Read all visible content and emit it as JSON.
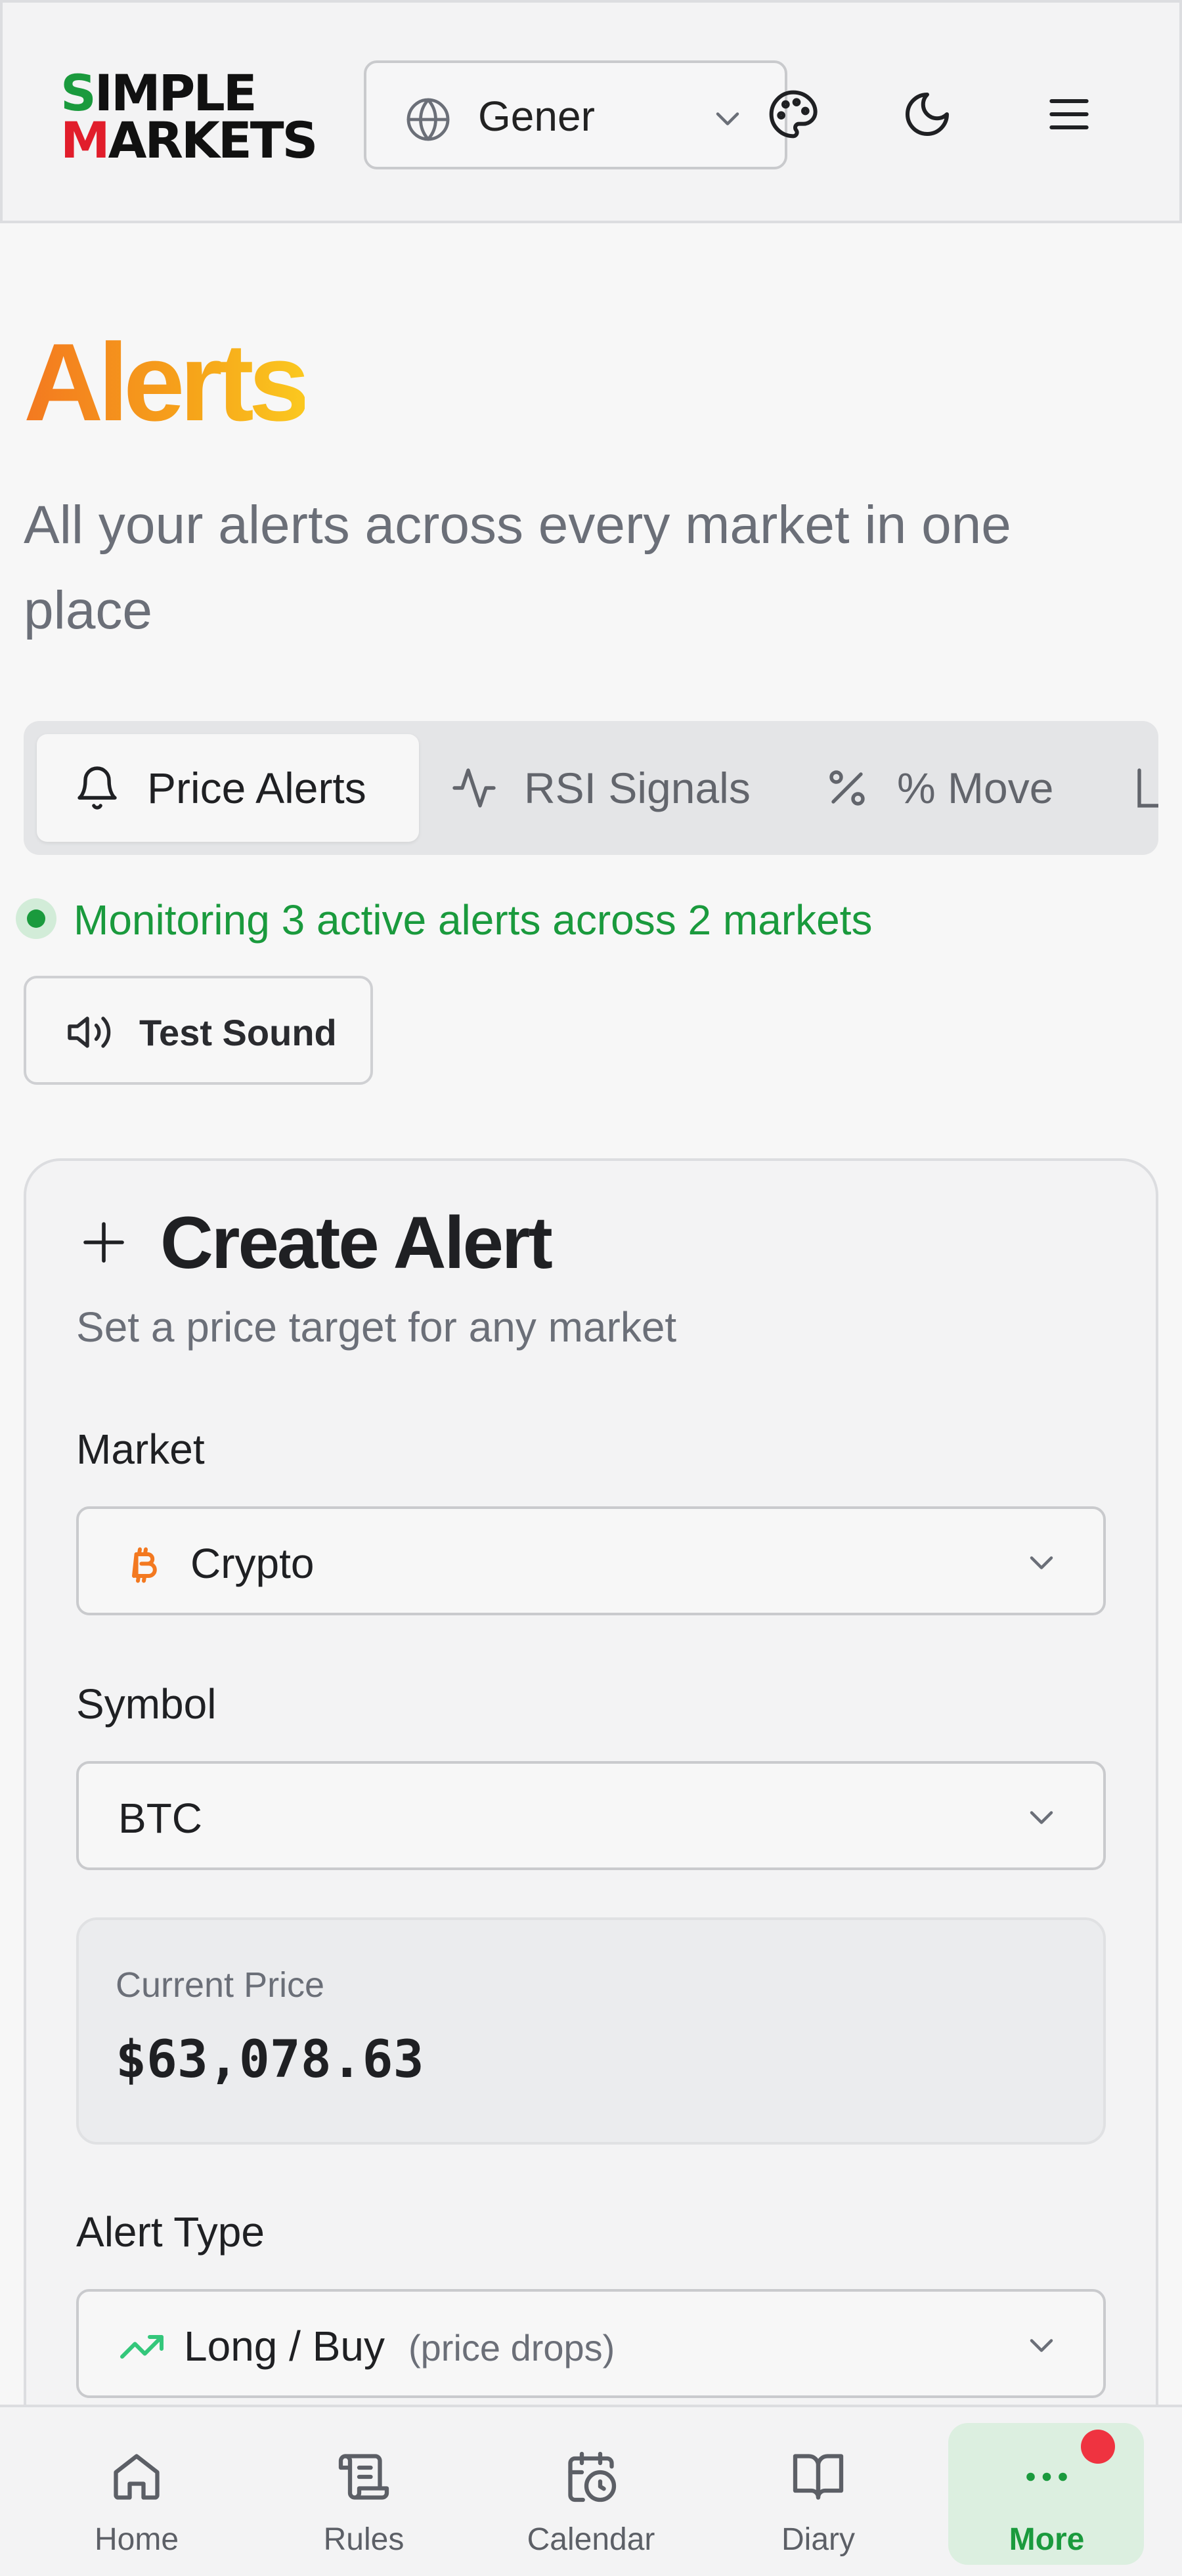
{
  "header": {
    "logo_line1": "SIMPLE",
    "logo_line2": "MARKETS",
    "language_value": "Gener",
    "icons": [
      "globe-icon",
      "chevron-down-icon",
      "palette-icon",
      "moon-icon",
      "menu-icon"
    ]
  },
  "page": {
    "title": "Alerts",
    "subtitle": "All your alerts across every market in one place"
  },
  "tabs": [
    {
      "label": "Price Alerts",
      "icon": "bell-icon",
      "active": true
    },
    {
      "label": "RSI Signals",
      "icon": "activity-icon",
      "active": false
    },
    {
      "label": "% Move",
      "icon": "percent-icon",
      "active": false
    }
  ],
  "status": {
    "text": "Monitoring 3 active alerts across 2 markets",
    "color": "#1a9a3d"
  },
  "test_sound": {
    "label": "Test Sound"
  },
  "create_alert": {
    "title": "Create Alert",
    "subtitle": "Set a price target for any market",
    "market": {
      "label": "Market",
      "value": "Crypto",
      "icon": "bitcoin-icon"
    },
    "symbol": {
      "label": "Symbol",
      "value": "BTC"
    },
    "current_price": {
      "label": "Current Price",
      "value": "$63,078.63"
    },
    "alert_type": {
      "label": "Alert Type",
      "value": "Long / Buy",
      "note": "(price drops)",
      "icon": "trending-up-icon"
    }
  },
  "bottom_nav": [
    {
      "label": "Home",
      "icon": "home-icon"
    },
    {
      "label": "Rules",
      "icon": "scroll-icon"
    },
    {
      "label": "Calendar",
      "icon": "calendar-clock-icon"
    },
    {
      "label": "Diary",
      "icon": "book-open-icon"
    },
    {
      "label": "More",
      "icon": "more-dots-icon",
      "active": true,
      "has_badge": true
    }
  ],
  "colors": {
    "accent_green": "#1a9a3d",
    "title_gradient_start": "#f37920",
    "title_gradient_end": "#fbc81f",
    "badge_red": "#ef3340",
    "bitcoin_orange": "#f37920"
  }
}
